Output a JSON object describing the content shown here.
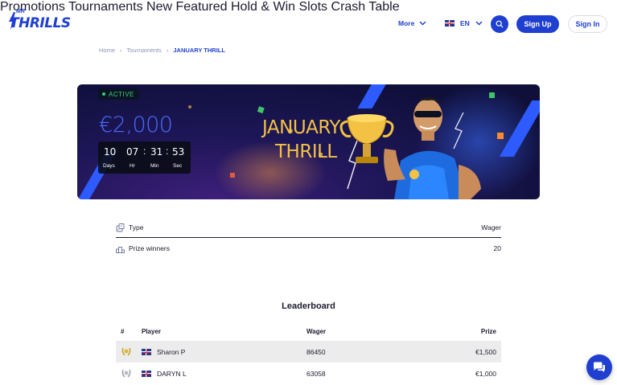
{
  "brand": {
    "logo_small": "MR",
    "logo_word": "THRILLS",
    "primary_color": "#1f3fd1"
  },
  "nav": {
    "items": [
      "Promotions",
      "Tournaments",
      "New",
      "Featured",
      "Hold & Win",
      "Slots",
      "Crash",
      "Table"
    ],
    "more_label": "More",
    "language": "EN",
    "signup_label": "Sign Up",
    "signin_label": "Sign In"
  },
  "breadcrumb": {
    "home": "Home",
    "section": "Tournaments",
    "current": "JANUARY THRILL",
    "separator": "›"
  },
  "banner": {
    "status": "ACTIVE",
    "prize": "€2,000",
    "title_line1": "JANUARY",
    "title_line2": "THRILL",
    "countdown": {
      "days": "10",
      "hours": "07",
      "minutes": "31",
      "seconds": "53",
      "days_label": "Days",
      "hours_label": "Hr",
      "minutes_label": "Min",
      "seconds_label": "Sec"
    }
  },
  "info": {
    "type_label": "Type",
    "type_value": "Wager",
    "winners_label": "Prize winners",
    "winners_value": "20"
  },
  "leaderboard": {
    "title": "Leaderboard",
    "columns": {
      "rank": "#",
      "player": "Player",
      "wager": "Wager",
      "prize": "Prize"
    },
    "rows": [
      {
        "player": "Sharon P",
        "wager": "86450",
        "prize": "€1,500",
        "medal": "gold-laurel"
      },
      {
        "player": "DARYN L",
        "wager": "63058",
        "prize": "€1,000",
        "medal": "silver-laurel"
      }
    ]
  }
}
